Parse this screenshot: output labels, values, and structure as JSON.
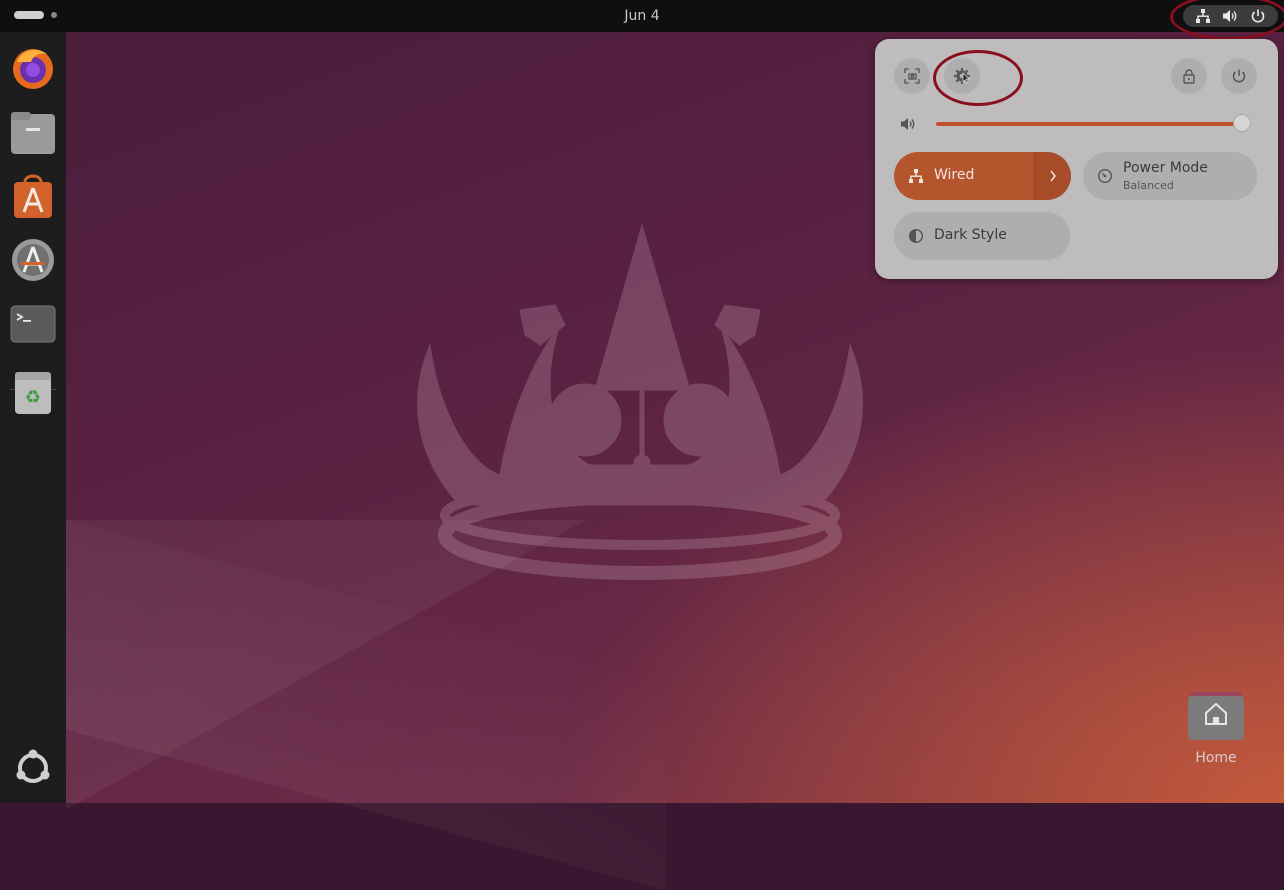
{
  "topbar": {
    "clock": "Jun 4",
    "tray_icons": [
      "network-icon",
      "volume-icon",
      "power-icon"
    ]
  },
  "dock": {
    "items": [
      {
        "name": "firefox",
        "icon": "firefox-icon"
      },
      {
        "name": "files",
        "icon": "files-icon"
      },
      {
        "name": "app-center",
        "icon": "app-center-icon"
      },
      {
        "name": "software-updater",
        "icon": "software-updater-icon"
      },
      {
        "name": "terminal",
        "icon": "terminal-icon"
      },
      {
        "name": "trash",
        "icon": "trash-icon"
      },
      {
        "name": "show-apps",
        "icon": "ubuntu-logo-icon"
      }
    ]
  },
  "quick_settings": {
    "header_buttons": [
      "screenshot-icon",
      "settings-icon",
      "lock-icon",
      "power-icon"
    ],
    "volume_percent": 100,
    "tiles": {
      "wired": {
        "label": "Wired",
        "active": true
      },
      "power_mode": {
        "label": "Power Mode",
        "subtitle": "Balanced"
      },
      "dark_style": {
        "label": "Dark Style"
      }
    },
    "accent_color": "#b5552e"
  },
  "desktop": {
    "home_label": "Home"
  },
  "annotations": {
    "highlight_color": "#8a0f1e"
  }
}
